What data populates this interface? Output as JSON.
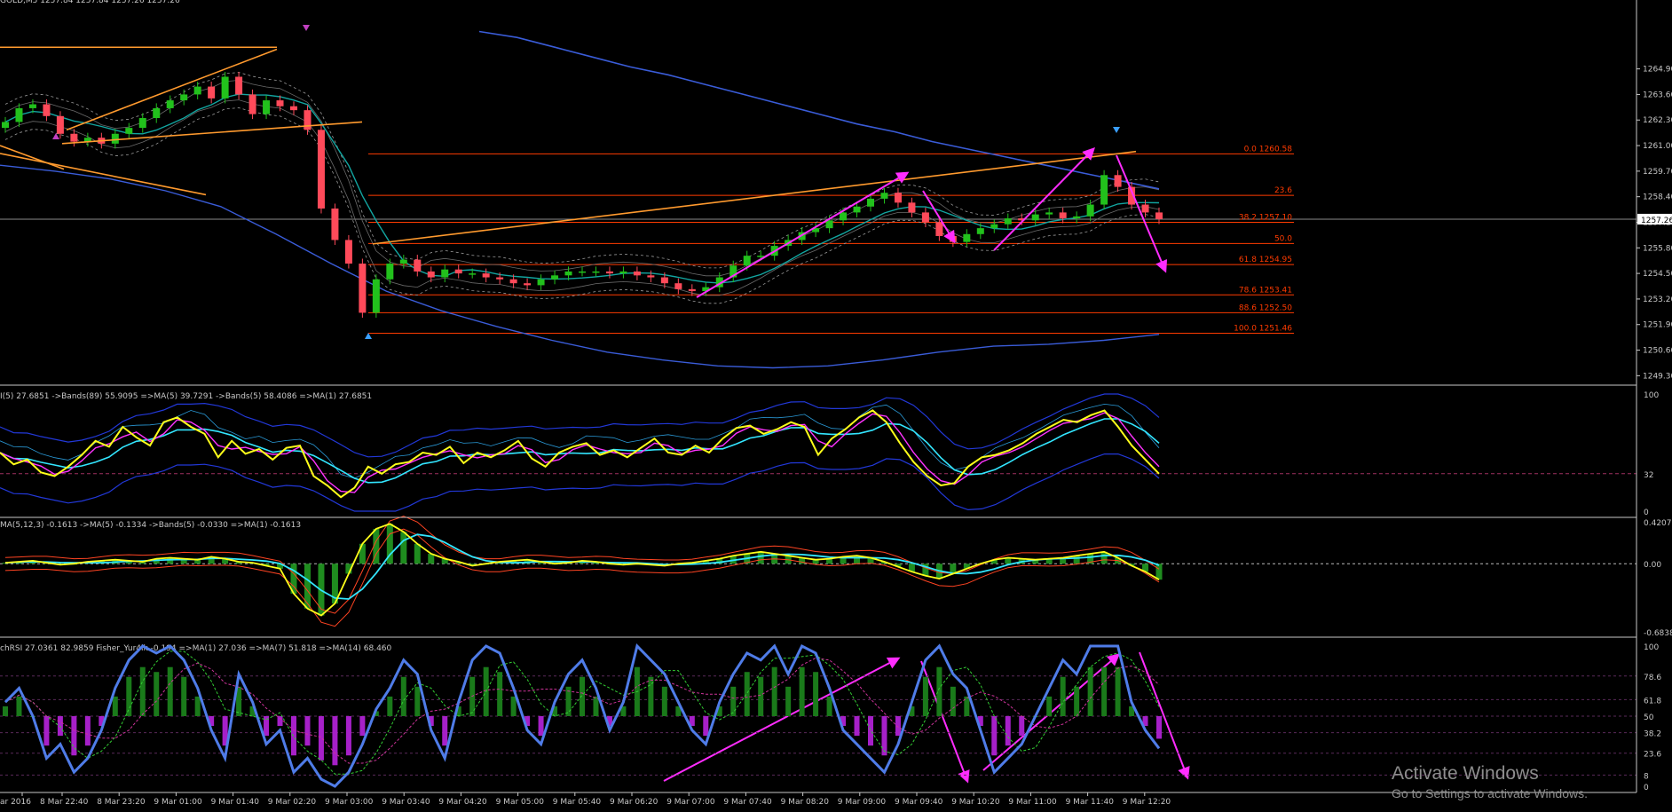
{
  "colors": {
    "background": "#000000",
    "axis": "#c8c8c8",
    "bull": "#22c11c",
    "bear": "#ff4a5a",
    "fib": "#ff3b00",
    "trend": "#ff9a2e",
    "arrow": "#ff2cff",
    "ma_slow": "#3a5cd8",
    "ma_teal": "#12a5a0",
    "band": "#9a9a9a",
    "rsi_yellow": "#ffff1a",
    "rsi_cyan": "#33e6ff",
    "rsi_magenta": "#ff33ff",
    "rsi_band": "#2238d8",
    "macd_hist": "#1f8c1f",
    "macd_red": "#ff4422",
    "stoch_blue": "#4f7ce8",
    "stoch_pos": "#1a7a1a",
    "stoch_neg": "#a620c8",
    "watermark": "#8d8d8d"
  },
  "chart_data": [
    {
      "type": "candlestick",
      "title": "GOLD,M5  1257.84 1257.84 1257.26 1257.26",
      "current_price": "1257.26",
      "ylim": [
        1249.0,
        1267.5
      ],
      "y_ticks": [
        "1264.90",
        "1263.60",
        "1262.30",
        "1261.00",
        "1259.70",
        "1258.40",
        "1257.10",
        "1255.80",
        "1254.50",
        "1253.20",
        "1251.90",
        "1250.60",
        "1249.30"
      ],
      "fib_levels": [
        {
          "label": "0.0 1260.58",
          "price": 1260.58
        },
        {
          "label": "23.6",
          "price": 1258.47
        },
        {
          "label": "38.2 1257.10",
          "price": 1257.1
        },
        {
          "label": "50.0",
          "price": 1256.02
        },
        {
          "label": "61.8 1254.95",
          "price": 1254.95
        },
        {
          "label": "78.6 1253.41",
          "price": 1253.41
        },
        {
          "label": "88.6 1252.50",
          "price": 1252.5
        },
        {
          "label": "100.0 1251.46",
          "price": 1251.46
        }
      ],
      "candles_close_path": [
        1262.2,
        1262.9,
        1263.1,
        1262.5,
        1261.6,
        1261.2,
        1261.4,
        1261.1,
        1261.6,
        1261.9,
        1262.4,
        1262.9,
        1263.3,
        1263.6,
        1264.0,
        1263.4,
        1264.5,
        1263.6,
        1262.6,
        1263.3,
        1263.0,
        1262.8,
        1261.8,
        1257.8,
        1256.2,
        1255.0,
        1252.5,
        1254.2,
        1255.0,
        1255.2,
        1254.6,
        1254.3,
        1254.7,
        1254.5,
        1254.5,
        1254.3,
        1254.2,
        1254.0,
        1253.9,
        1254.2,
        1254.4,
        1254.6,
        1254.6,
        1254.6,
        1254.5,
        1254.6,
        1254.4,
        1254.3,
        1254.0,
        1253.7,
        1253.6,
        1253.8,
        1254.3,
        1254.9,
        1255.4,
        1255.4,
        1255.9,
        1256.2,
        1256.6,
        1256.8,
        1257.2,
        1257.6,
        1257.9,
        1258.3,
        1258.6,
        1258.1,
        1257.6,
        1257.1,
        1256.4,
        1256.1,
        1256.5,
        1256.8,
        1257.0,
        1257.3,
        1257.2,
        1257.5,
        1257.6,
        1257.3,
        1257.4,
        1258.0,
        1259.5,
        1258.9,
        1258.0,
        1257.6,
        1257.26
      ],
      "series": [
        {
          "name": "MA-slow",
          "values": [
            1260.0,
            1259.7,
            1259.3,
            1258.7,
            1257.9,
            1256.5,
            1255.0,
            1253.6,
            1252.6,
            1251.8,
            1251.1,
            1250.5,
            1250.1,
            1249.8,
            1249.7,
            1249.8,
            1250.1,
            1250.5,
            1250.8,
            1250.9,
            1251.1,
            1251.4
          ]
        },
        {
          "name": "MA-falling",
          "values": [
            1266.8,
            1266.5,
            1266.0,
            1265.5,
            1265.0,
            1264.6,
            1264.1,
            1263.6,
            1263.1,
            1262.6,
            1262.1,
            1261.7,
            1261.2,
            1260.8,
            1260.4,
            1260.0,
            1259.6,
            1259.2,
            1258.8
          ]
        }
      ],
      "arrows": [
        "up",
        "up",
        "up",
        "down",
        "up",
        "down"
      ]
    },
    {
      "type": "line",
      "header": "I(5) 27.6851  ->Bands(89) 55.9095  =>MA(5) 39.7291  ->Bands(5) 58.4086  =>MA(1) 27.6851",
      "ylim": [
        0,
        100
      ],
      "y_ticks": [
        "100",
        "32",
        "0"
      ],
      "level": 32,
      "series": [
        {
          "name": "RSI",
          "values": [
            50,
            40,
            44,
            33,
            30,
            38,
            48,
            60,
            55,
            72,
            63,
            56,
            76,
            80,
            72,
            66,
            46,
            60,
            49,
            53,
            44,
            54,
            56,
            30,
            22,
            12,
            20,
            38,
            32,
            40,
            42,
            50,
            48,
            55,
            41,
            50,
            46,
            52,
            60,
            45,
            38,
            50,
            55,
            58,
            48,
            52,
            46,
            54,
            62,
            50,
            48,
            56,
            50,
            62,
            71,
            73,
            66,
            70,
            76,
            72,
            48,
            62,
            70,
            80,
            86,
            76,
            58,
            42,
            30,
            22,
            24,
            38,
            46,
            48,
            52,
            58,
            66,
            72,
            78,
            76,
            82,
            86,
            72,
            56,
            44,
            32
          ]
        }
      ]
    },
    {
      "type": "bar",
      "header": "MA(5,12,3) -0.1613  ->MA(5) -0.1334  ->Bands(5) -0.0330  =>MA(1) -0.1613",
      "ylim": [
        -0.6838,
        0.4207
      ],
      "y_ticks": [
        "0.4207",
        "0.00",
        "-0.6838"
      ],
      "values": [
        0.01,
        0.02,
        0.03,
        0.01,
        -0.01,
        0.0,
        0.02,
        0.03,
        0.04,
        0.03,
        0.02,
        0.05,
        0.06,
        0.05,
        0.04,
        0.07,
        0.05,
        0.02,
        0.01,
        -0.02,
        -0.05,
        -0.3,
        -0.45,
        -0.52,
        -0.4,
        -0.1,
        0.2,
        0.35,
        0.4,
        0.32,
        0.2,
        0.1,
        0.05,
        0.02,
        -0.02,
        0.0,
        0.02,
        0.03,
        0.04,
        0.02,
        0.0,
        0.01,
        0.03,
        0.02,
        0.0,
        -0.01,
        0.0,
        -0.01,
        -0.02,
        0.0,
        0.01,
        0.03,
        0.05,
        0.08,
        0.1,
        0.12,
        0.1,
        0.08,
        0.06,
        0.04,
        0.05,
        0.07,
        0.08,
        0.06,
        0.02,
        -0.03,
        -0.08,
        -0.12,
        -0.15,
        -0.1,
        -0.05,
        0.0,
        0.04,
        0.06,
        0.05,
        0.04,
        0.05,
        0.06,
        0.08,
        0.1,
        0.12,
        0.06,
        -0.02,
        -0.08,
        -0.16
      ]
    },
    {
      "type": "line",
      "header": "chRSI 27.0361 82.9859  Fisher_Yur4ik -0.194  =>MA(1) 27.036  =>MA(7) 51.818  =>MA(14) 68.460",
      "ylim": [
        0,
        100
      ],
      "y_ticks": [
        "100",
        "78.6",
        "61.8",
        "50",
        "38.2",
        "23.6",
        "8",
        "0"
      ],
      "x_ticks": [
        "ar 2016",
        "8 Mar 22:40",
        "8 Mar 23:20",
        "9 Mar 01:00",
        "9 Mar 01:40",
        "9 Mar 02:20",
        "9 Mar 03:00",
        "9 Mar 03:40",
        "9 Mar 04:20",
        "9 Mar 05:00",
        "9 Mar 05:40",
        "9 Mar 06:20",
        "9 Mar 07:00",
        "9 Mar 07:40",
        "9 Mar 08:20",
        "9 Mar 09:00",
        "9 Mar 09:40",
        "9 Mar 10:20",
        "9 Mar 11:00",
        "9 Mar 11:40",
        "9 Mar 12:20"
      ],
      "series": [
        {
          "name": "StochRSI",
          "values": [
            60,
            70,
            50,
            20,
            30,
            10,
            20,
            40,
            70,
            90,
            100,
            95,
            100,
            90,
            70,
            40,
            20,
            80,
            60,
            30,
            40,
            10,
            20,
            5,
            0,
            10,
            30,
            55,
            70,
            90,
            80,
            40,
            20,
            60,
            90,
            100,
            95,
            70,
            40,
            30,
            60,
            80,
            90,
            70,
            40,
            60,
            100,
            90,
            80,
            60,
            40,
            30,
            60,
            80,
            95,
            90,
            100,
            80,
            100,
            95,
            70,
            40,
            30,
            20,
            10,
            30,
            60,
            90,
            100,
            80,
            70,
            40,
            10,
            20,
            30,
            50,
            70,
            90,
            80,
            100,
            100,
            100,
            60,
            40,
            27
          ]
        }
      ]
    }
  ],
  "watermark": {
    "line1": "Activate Windows",
    "line2": "Go to Settings to activate Windows."
  }
}
